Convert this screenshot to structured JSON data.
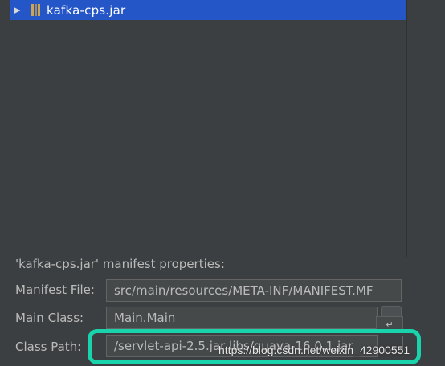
{
  "tree": {
    "items": [
      {
        "label": "kafka-cps.jar",
        "icon": "jar-icon",
        "expanded": false,
        "selected": true
      }
    ]
  },
  "manifest": {
    "section_title": "'kafka-cps.jar' manifest properties:",
    "manifest_file_label": "Manifest File:",
    "manifest_file_value": "src/main/resources/META-INF/MANIFEST.MF",
    "main_class_label": "Main Class:",
    "main_class_value": "Main.Main",
    "class_path_label": "Class Path:",
    "class_path_value": "/servlet-api-2.5.jar libs/guava-16.0.1.jar"
  },
  "watermark": "https://blog.csdn.net/weixin_42900551",
  "colors": {
    "selection": "#2456c8",
    "highlight": "#19d3ad",
    "background": "#3c3f41"
  }
}
